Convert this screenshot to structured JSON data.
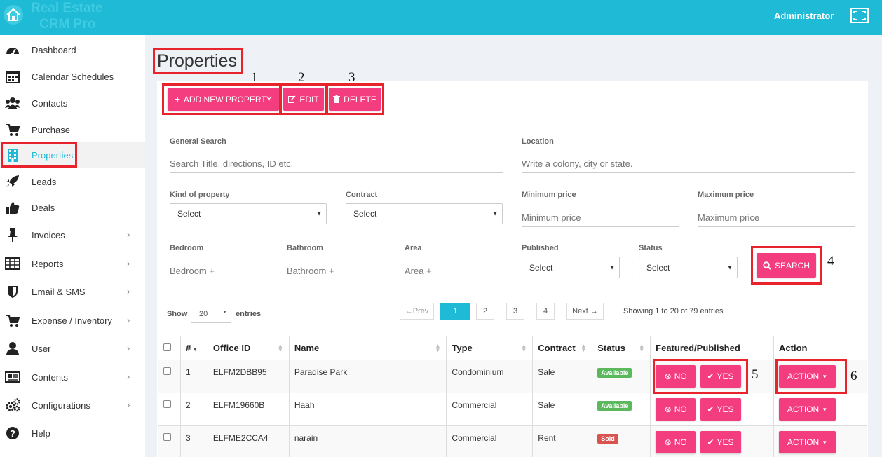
{
  "brand": {
    "line1": "Real Estate",
    "line2": "CRM Pro"
  },
  "header": {
    "user": "Administrator"
  },
  "sidebar": {
    "items": [
      {
        "label": "Dashboard",
        "icon": "dashboard-icon"
      },
      {
        "label": "Calendar Schedules",
        "icon": "calendar-icon"
      },
      {
        "label": "Contacts",
        "icon": "users-icon"
      },
      {
        "label": "Purchase",
        "icon": "cart-icon"
      },
      {
        "label": "Properties",
        "icon": "building-icon"
      },
      {
        "label": "Leads",
        "icon": "rocket-icon"
      },
      {
        "label": "Deals",
        "icon": "thumbs-up-icon"
      },
      {
        "label": "Invoices",
        "icon": "pin-icon"
      },
      {
        "label": "Reports",
        "icon": "table-icon"
      },
      {
        "label": "Email & SMS",
        "icon": "shield-icon"
      },
      {
        "label": "Expense / Inventory",
        "icon": "cart-icon"
      },
      {
        "label": "User",
        "icon": "user-icon"
      },
      {
        "label": "Contents",
        "icon": "newspaper-icon"
      },
      {
        "label": "Configurations",
        "icon": "cogs-icon"
      },
      {
        "label": "Help",
        "icon": "question-icon"
      }
    ],
    "chevron": "›"
  },
  "page": {
    "title": "Properties"
  },
  "toolbar": {
    "add_label": "ADD NEW PROPERTY",
    "edit_label": "EDIT",
    "delete_label": "DELETE"
  },
  "annotations": [
    "1",
    "2",
    "3",
    "4",
    "5",
    "6"
  ],
  "search": {
    "general_label": "General Search",
    "general_placeholder": "Search Title, directions, ID etc.",
    "location_label": "Location",
    "location_placeholder": "Write a colony, city or state.",
    "kind_label": "Kind of property",
    "kind_value": "Select",
    "contract_label": "Contract",
    "contract_value": "Select",
    "minprice_label": "Minimum price",
    "minprice_placeholder": "Minimum price",
    "maxprice_label": "Maximum price",
    "maxprice_placeholder": "Maximum price",
    "bedroom_label": "Bedroom",
    "bedroom_placeholder": "Bedroom +",
    "bathroom_label": "Bathroom",
    "bathroom_placeholder": "Bathroom +",
    "area_label": "Area",
    "area_placeholder": "Area +",
    "published_label": "Published",
    "published_value": "Select",
    "status_label": "Status",
    "status_value": "Select",
    "search_button": "SEARCH"
  },
  "listing": {
    "show_label": "Show",
    "entries_value": "20",
    "entries_label": "entries",
    "prev": "←Prev",
    "pages": [
      "1",
      "2",
      "3",
      "4"
    ],
    "next": "Next →",
    "summary": "Showing 1 to 20 of 79 entries"
  },
  "table": {
    "headers": [
      "#",
      "Office ID",
      "Name",
      "Type",
      "Contract",
      "Status",
      "Featured/Published",
      "Action"
    ],
    "rows": [
      {
        "num": "1",
        "office_id": "ELFM2DBB95",
        "name": "Paradise Park",
        "type": "Condominium",
        "contract": "Sale",
        "status": "Available"
      },
      {
        "num": "2",
        "office_id": "ELFM19660B",
        "name": "Haah",
        "type": "Commercial",
        "contract": "Sale",
        "status": "Available"
      },
      {
        "num": "3",
        "office_id": "ELFME2CCA4",
        "name": "narain",
        "type": "Commercial",
        "contract": "Rent",
        "status": "Sold"
      }
    ],
    "no_label": "NO",
    "yes_label": "YES",
    "action_label": "ACTION"
  },
  "colors": {
    "accent": "#1fbad6",
    "button": "#f43d7e",
    "available": "#5cb85c",
    "sold": "#d9534f",
    "highlight": "#e8232b"
  }
}
